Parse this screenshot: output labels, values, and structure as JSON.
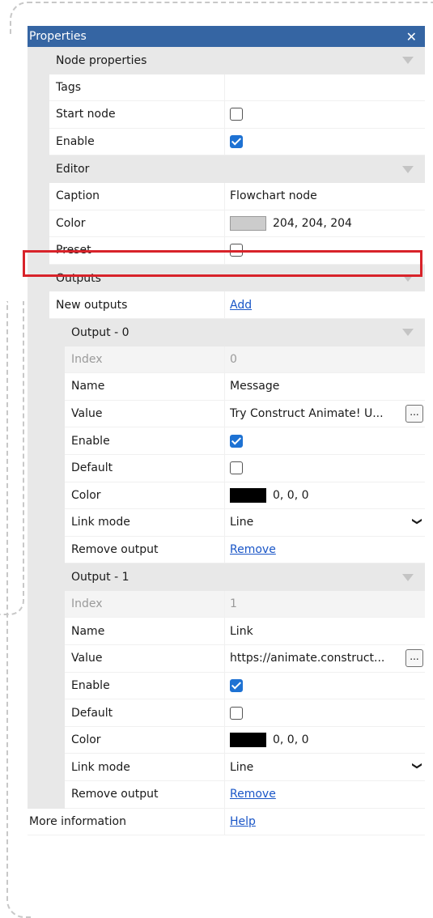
{
  "panel": {
    "title": "Properties",
    "close_label": "✕"
  },
  "node_properties": {
    "header": "Node properties",
    "tags_label": "Tags",
    "tags_value": "",
    "start_node_label": "Start node",
    "start_node_checked": false,
    "enable_label": "Enable",
    "enable_checked": true
  },
  "editor": {
    "header": "Editor",
    "caption_label": "Caption",
    "caption_value": "Flowchart node",
    "color_label": "Color",
    "color_value": "204, 204, 204",
    "color_hex": "#cccccc",
    "preset_label": "Preset",
    "preset_checked": false
  },
  "outputs": {
    "header": "Outputs",
    "new_outputs_label": "New outputs",
    "add_label": "Add",
    "items": [
      {
        "header": "Output - 0",
        "index_label": "Index",
        "index_value": "0",
        "name_label": "Name",
        "name_value": "Message",
        "value_label": "Value",
        "value_value": "Try Construct Animate! U...",
        "enable_label": "Enable",
        "enable_checked": true,
        "default_label": "Default",
        "default_checked": false,
        "color_label": "Color",
        "color_value": "0, 0, 0",
        "color_hex": "#000000",
        "link_mode_label": "Link mode",
        "link_mode_value": "Line",
        "remove_label": "Remove output",
        "remove_link": "Remove"
      },
      {
        "header": "Output - 1",
        "index_label": "Index",
        "index_value": "1",
        "name_label": "Name",
        "name_value": "Link",
        "value_label": "Value",
        "value_value": "https://animate.construct...",
        "enable_label": "Enable",
        "enable_checked": true,
        "default_label": "Default",
        "default_checked": false,
        "color_label": "Color",
        "color_value": "0, 0, 0",
        "color_hex": "#000000",
        "link_mode_label": "Link mode",
        "link_mode_value": "Line",
        "remove_label": "Remove output",
        "remove_link": "Remove"
      }
    ]
  },
  "more_info": {
    "label": "More information",
    "help_link": "Help"
  },
  "ellipsis": "...",
  "chevron": "⌄",
  "colors": {
    "titlebar": "#3565a3",
    "checkbox_on": "#1e72d3",
    "highlight": "#d8232a",
    "link": "#1a56c7"
  }
}
